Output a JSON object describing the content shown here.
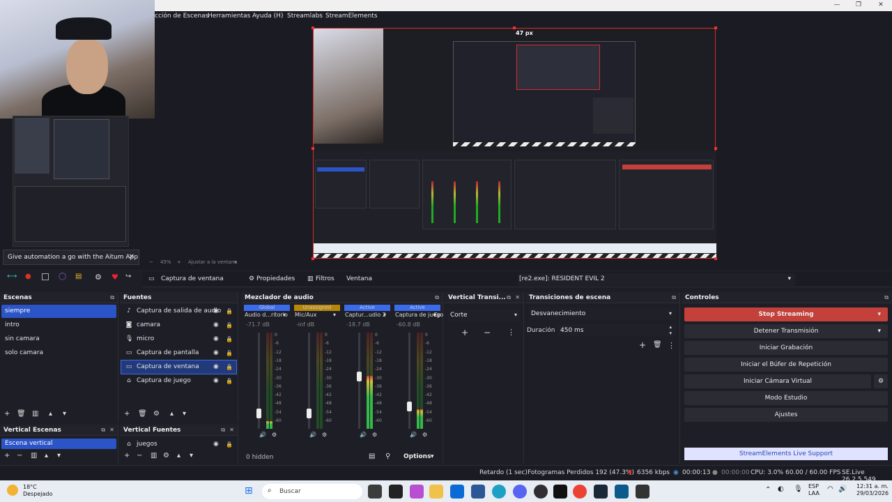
{
  "window": {
    "minimize": "—",
    "maximize": "❐",
    "close": "✕"
  },
  "menu": [
    "cción de Escenas",
    "Herramientas",
    "Ayuda (H)",
    "Streamlabs",
    "StreamElements"
  ],
  "preview": {
    "size_label": "47 px",
    "zoom": "45%",
    "fit_label": "Ajustar a la ventana",
    "popup_text": "Give automation a go with the Aitum App"
  },
  "source_toolbar": {
    "source_name": "Captura de ventana",
    "properties": "Propiedades",
    "filters": "Filtros",
    "window_label": "Ventana",
    "window_value": "[re2.exe]: RESIDENT EVIL 2"
  },
  "scenes": {
    "title": "Escenas",
    "items": [
      "siempre",
      "intro",
      "sin camara",
      "solo camara"
    ],
    "selected": "siempre"
  },
  "sources": {
    "title": "Fuentes",
    "items": [
      {
        "label": "Captura de salida de audio",
        "icon": "speaker-icon"
      },
      {
        "label": "camara",
        "icon": "camera-icon"
      },
      {
        "label": "micro",
        "icon": "microphone-icon"
      },
      {
        "label": "Captura de pantalla",
        "icon": "monitor-icon"
      },
      {
        "label": "Captura de ventana",
        "icon": "window-icon"
      },
      {
        "label": "Captura de juego",
        "icon": "gamepad-icon"
      }
    ],
    "selected": "Captura de ventana"
  },
  "vertical_scenes": {
    "title": "Vertical Escenas",
    "items": [
      "Escena vertical"
    ]
  },
  "vertical_sources": {
    "title": "Vertical Fuentes",
    "items": [
      "juegos"
    ]
  },
  "mixer": {
    "title": "Mezclador de audio",
    "channels": [
      {
        "tag": "Global",
        "name": "Audio d...ritorio",
        "db": "-71.7 dB",
        "tag_color": "#3b6bea",
        "level": 0.08
      },
      {
        "tag": "Unassigned",
        "name": "Mic/Aux",
        "db": "-inf dB",
        "tag_color": "#b8860b",
        "level": 0.0
      },
      {
        "tag": "Active",
        "name": "Captur...udio 2",
        "db": "-18.7 dB",
        "tag_color": "#3b6bea",
        "level": 0.55
      },
      {
        "tag": "Active",
        "name": "Captura de juego",
        "db": "-60.8 dB",
        "tag_color": "#3b6bea",
        "level": 0.2
      }
    ],
    "cut_label": "Cp",
    "ticks": [
      "0",
      "-6",
      "-12",
      "-18",
      "-24",
      "-30",
      "-36",
      "-42",
      "-48",
      "-54",
      "-60"
    ],
    "hidden_label": "0 hidden",
    "options_label": "Options"
  },
  "vertical_transition": {
    "title": "Vertical Transi...",
    "value": "Corte"
  },
  "scene_transitions": {
    "title": "Transiciones de escena",
    "value": "Desvanecimiento",
    "duration_label": "Duración",
    "duration_value": "450 ms"
  },
  "controls": {
    "title": "Controles",
    "stop_streaming": "Stop Streaming",
    "buttons": [
      "Detener Transmisión",
      "Iniciar Grabación",
      "Iniciar el Búfer de Repetición",
      "Iniciar Cámara Virtual",
      "Modo Estudio",
      "Ajustes"
    ],
    "support": "StreamElements Live Support",
    "stop_color": "#c4403b"
  },
  "status": {
    "delay": "Retardo (1 sec)",
    "dropped": "Fotogramas Perdidos 192 (47.3%)",
    "bitrate": "6356 kbps",
    "stream_time": "00:00:13",
    "rec_time": "00:00:00",
    "cpu": "CPU: 3.0%",
    "fps": "60.00 / 60.00 FPS",
    "version": "SE.Live 26.2.5.549"
  },
  "taskbar": {
    "temp": "18°C",
    "weather": "Despejado",
    "search": "Buscar",
    "lang1": "ESP",
    "lang2": "LAA",
    "time": "12:31 a. m.",
    "date": "29/03/2026"
  }
}
